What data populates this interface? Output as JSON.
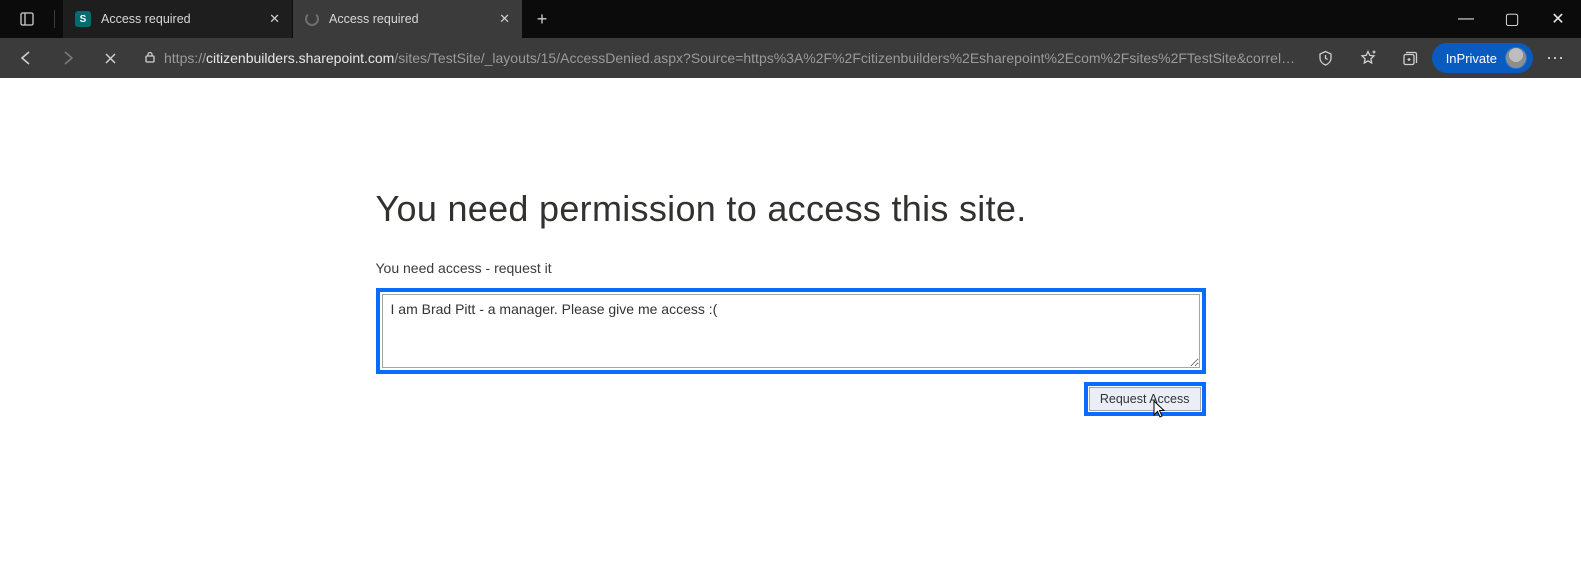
{
  "window": {
    "minimize_glyph": "—",
    "maximize_glyph": "▢",
    "close_glyph": "✕"
  },
  "tabs": [
    {
      "title": "Access required",
      "favicon_letter": "S",
      "active": false
    },
    {
      "title": "Access required",
      "close_glyph": "✕",
      "active": true
    }
  ],
  "newtab_glyph": "+",
  "toolbar": {
    "tab_close_glyph": "✕",
    "lock_glyph": "🔒",
    "star_glyph": "✩",
    "url_prefix": "https://",
    "url_host": "citizenbuilders.sharepoint.com",
    "url_path": "/sites/TestSite/_layouts/15/AccessDenied.aspx?Source=https%3A%2F%2Fcitizenbuilders%2Esharepoint%2Ecom%2Fsites%2FTestSite&correl…",
    "inprivate_label": "InPrivate",
    "more_glyph": "⋯"
  },
  "page": {
    "heading": "You need permission to access this site.",
    "subhead": "You need access - request it",
    "message_value": "I am Brad Pitt - a manager. Please give me access :(",
    "request_button": "Request Access"
  }
}
